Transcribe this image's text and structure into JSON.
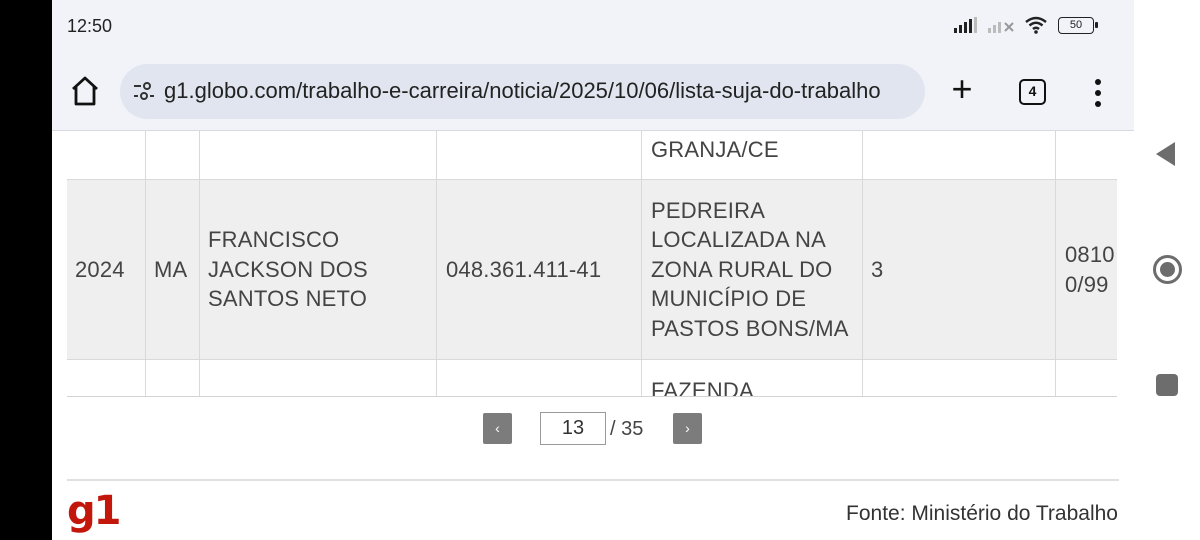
{
  "status_bar": {
    "time": "12:50",
    "battery": "50"
  },
  "browser": {
    "url": "g1.globo.com/trabalho-e-carreira/noticia/2025/10/06/lista-suja-do-trabalho",
    "tab_count": "4",
    "new_tab_label": "+"
  },
  "table": {
    "top_row": {
      "establishment_tail": "GRANJA/CE"
    },
    "main_row": {
      "year": "2024",
      "state": "MA",
      "employer_lines": [
        "FRANCISCO",
        "JACKSON DOS",
        "SANTOS NETO"
      ],
      "document": "048.361.411-41",
      "establishment_lines": [
        "PEDREIRA",
        "LOCALIZADA NA",
        "ZONA RURAL DO",
        "MUNICÍPIO DE",
        "PASTOS BONS/MA"
      ],
      "workers": "3",
      "case_lines": [
        "0810",
        "0/99"
      ]
    },
    "bottom_row": {
      "establishment_head": "FAZENDA"
    }
  },
  "pager": {
    "prev": "‹",
    "next": "›",
    "current": "13",
    "total": "/ 35"
  },
  "footer": {
    "logo": "g1",
    "source": "Fonte: Ministério do Trabalho"
  }
}
